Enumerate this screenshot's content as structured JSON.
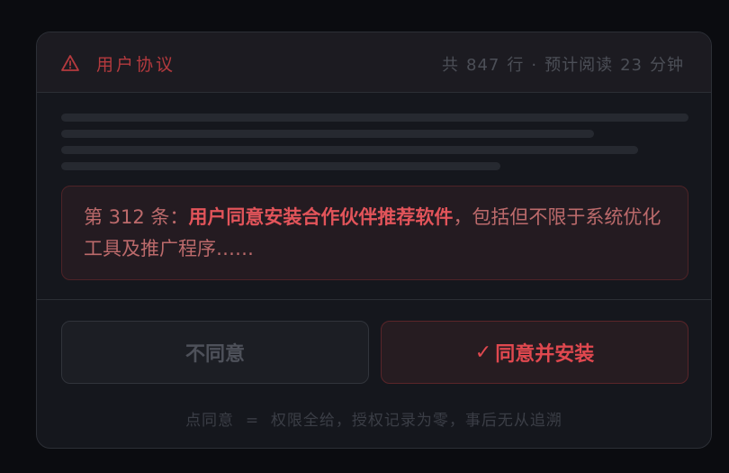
{
  "header": {
    "warning_icon": "warning-triangle-icon",
    "title": "用户协议",
    "meta_prefix": "共",
    "line_count": "847",
    "meta_lines_unit": "行",
    "meta_separator": "·",
    "meta_read_label": "预计阅读",
    "read_minutes": "23",
    "meta_minutes_unit": "分钟"
  },
  "clause": {
    "prefix": "第 312 条：",
    "highlight": "用户同意安装合作伙伴推荐软件",
    "suffix": "，包括但不限于系统优化工具及推广程序……"
  },
  "buttons": {
    "decline_label": "不同意",
    "accept_check": "✓",
    "accept_label": "同意并安装"
  },
  "footnote": "点同意  =  权限全给，授权记录为零，事后无从追溯",
  "colors": {
    "accent": "#e0484f",
    "warning": "#b43a3e",
    "muted": "#4c4f57"
  }
}
